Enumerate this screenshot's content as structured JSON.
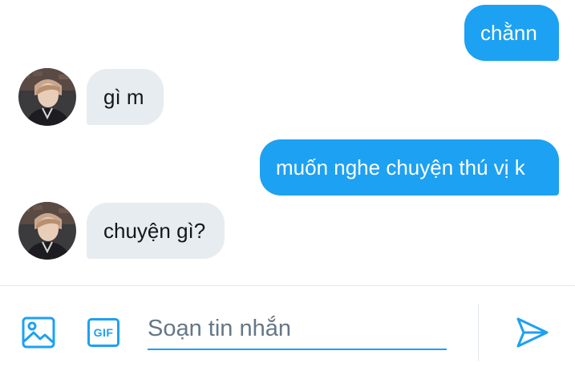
{
  "conversation": {
    "messages": [
      {
        "side": "sent",
        "text": "chằnn"
      },
      {
        "side": "received",
        "text": "gì m"
      },
      {
        "side": "sent",
        "text": "muốn nghe chuyện thú vị k"
      },
      {
        "side": "received",
        "text": "chuyện gì?"
      }
    ]
  },
  "composer": {
    "placeholder": "Soạn tin nhắn",
    "value": "",
    "gif_label": "GIF",
    "icons": {
      "media": "image-icon",
      "gif": "gif-icon",
      "send": "send-icon"
    }
  },
  "colors": {
    "accent": "#1da1f2",
    "received_bubble": "#e6ecf0",
    "received_text": "#14171a",
    "sent_text": "#ffffff",
    "placeholder": "#657786",
    "divider": "#e1e8ed"
  }
}
